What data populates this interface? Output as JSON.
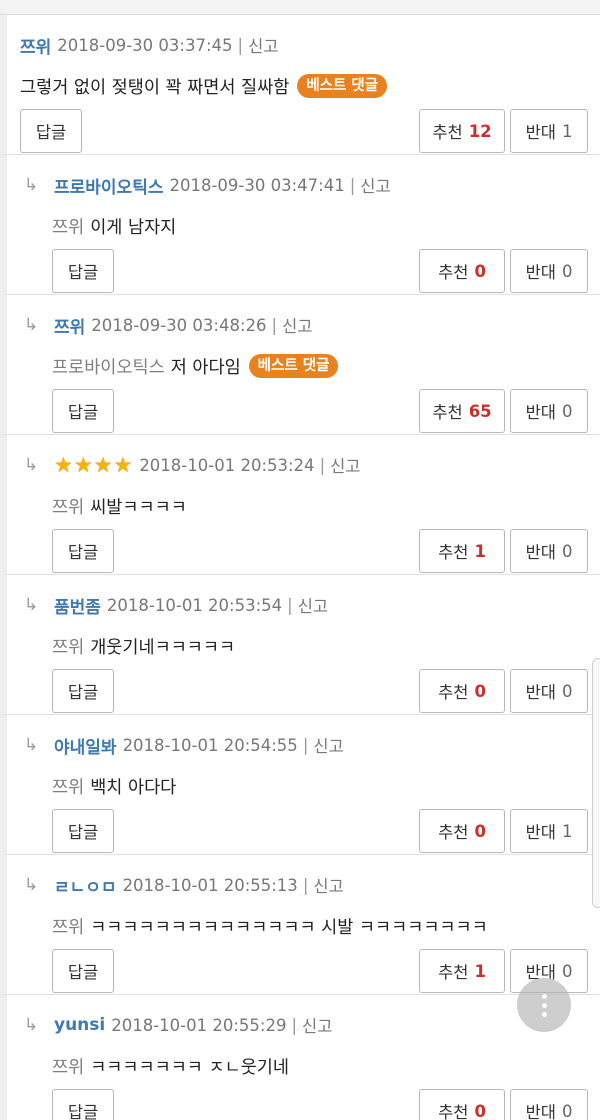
{
  "labels": {
    "reply": "답글",
    "up": "추천",
    "down": "반대",
    "report": "신고",
    "best": "베스트 댓글",
    "arrow": "↳",
    "sep": "|"
  },
  "colors": {
    "author": "#3f79b0",
    "badge": "#e8821f",
    "vote_red": "#c9302c"
  },
  "comments": [
    {
      "author": "쯔위",
      "date": "2018-09-30 03:37:45",
      "mention": "",
      "text": "그렇거 없이 젖탱이 꽉 짜면서 질싸함",
      "best": true,
      "up": "12",
      "down": "1"
    },
    {
      "author": "프로바이오틱스",
      "date": "2018-09-30 03:47:41",
      "mention": "쯔위",
      "text": "이게 남자지",
      "best": false,
      "up": "0",
      "down": "0"
    },
    {
      "author": "쯔위",
      "date": "2018-09-30 03:48:26",
      "mention": "프로바이오틱스",
      "text": "저 아다임",
      "best": true,
      "up": "65",
      "down": "0"
    },
    {
      "author": "★★★★",
      "date": "2018-10-01 20:53:24",
      "mention": "쯔위",
      "text": "씨발ㅋㅋㅋㅋ",
      "best": false,
      "up": "1",
      "down": "0"
    },
    {
      "author": "품번좀",
      "date": "2018-10-01 20:53:54",
      "mention": "쯔위",
      "text": "개웃기네ㅋㅋㅋㅋㅋ",
      "best": false,
      "up": "0",
      "down": "0"
    },
    {
      "author": "야내일봐",
      "date": "2018-10-01 20:54:55",
      "mention": "쯔위",
      "text": "백치 아다다",
      "best": false,
      "up": "0",
      "down": "1"
    },
    {
      "author": "ㄹㄴㅇㅁ",
      "date": "2018-10-01 20:55:13",
      "mention": "쯔위",
      "text": "ㅋㅋㅋㅋㅋㅋㅋㅋㅋㅋㅋㅋㅋㅋ 시발 ㅋㅋㅋㅋㅋㅋㅋㅋ",
      "best": false,
      "up": "1",
      "down": "0"
    },
    {
      "author": "yunsi",
      "date": "2018-10-01 20:55:29",
      "mention": "쯔위",
      "text": "ㅋㅋㅋㅋㅋㅋㅋ ㅈㄴ웃기네",
      "best": false,
      "up": "0",
      "down": "0"
    }
  ]
}
